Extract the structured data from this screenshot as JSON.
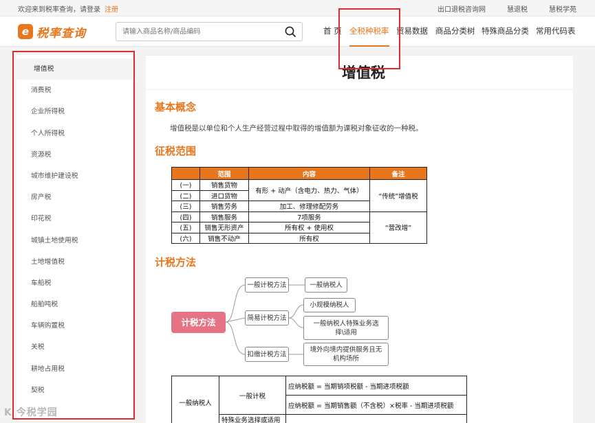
{
  "topbar": {
    "welcome": "欢迎来到税率查询，请登录",
    "register": "注册",
    "links": [
      "出口退税咨询网",
      "慧退税",
      "慧税学苑"
    ]
  },
  "header": {
    "logo_mark": "e",
    "logo_text": "税率查询",
    "search_placeholder": "请输入商品名称/商品编码",
    "nav": [
      "首 页",
      "全税种税率",
      "贸易数据",
      "商品分类树",
      "特殊商品分类",
      "常用代码表"
    ]
  },
  "sidebar": {
    "items": [
      "增值税",
      "消费税",
      "企业所得税",
      "个人所得税",
      "资源税",
      "城市维护建设税",
      "房产税",
      "印花税",
      "城镇土地使用税",
      "土地增值税",
      "车船税",
      "船舶吨税",
      "车辆购置税",
      "关税",
      "耕地占用税",
      "契税"
    ]
  },
  "content": {
    "title": "增值税",
    "section1": "基本概念",
    "concept": "增值税是以单位和个人生产经营过程中取得的增值额为课税对象征收的一种税。",
    "section2": "征税范围",
    "scope_table": {
      "headers": [
        "",
        "范围",
        "内容",
        "备注"
      ],
      "rows": [
        [
          "(一)",
          "销售货物"
        ],
        [
          "(二)",
          "进口货物"
        ],
        [
          "(三)",
          "销售劳务"
        ],
        [
          "(四)",
          "销售服务"
        ],
        [
          "(五)",
          "销售无形资产"
        ],
        [
          "(六)",
          "销售不动产"
        ]
      ],
      "content_goods": "有形 + 动产（含电力、热力、气体）",
      "content_labor": "加工、修理修配劳务",
      "content_service": "7项服务",
      "content_intangible": "所有权 + 使用权",
      "content_realestate": "所有权",
      "note_traditional": "“传统”增值税",
      "note_reform": "“营改增”"
    },
    "section3": "计税方法",
    "diagram": {
      "root": "计税方法",
      "m1": "一般计税方法",
      "m1_child": "一般纳税人",
      "m2": "简易计税方法",
      "m2_child1": "小规模纳税人",
      "m2_child2": "一般纳税人特殊业务选择\\适用",
      "m3": "扣缴计税方法",
      "m3_child": "境外向境内提供服务且无机构场所"
    },
    "calc_table": {
      "payer": "一般纳税人",
      "method": "一般计税",
      "formula1": "应纳税额 = 当期销项税额 - 当期进项税额",
      "formula2": "应纳税额 = 当期销售额（不含税）×税率 - 当期进项税额",
      "partial": "特殊业务选择或适用"
    }
  },
  "watermark": "K 今税学园"
}
